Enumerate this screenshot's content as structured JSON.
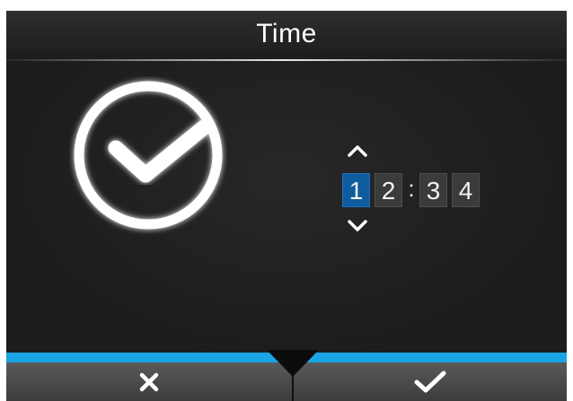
{
  "header": {
    "title": "Time"
  },
  "time_setting": {
    "digits": [
      "1",
      "2",
      "3",
      "4"
    ],
    "separator": ":",
    "selected_index": 0
  },
  "icons": {
    "main": "clock-check-icon",
    "increase": "chevron-up-icon",
    "decrease": "chevron-down-icon",
    "cancel": "close-icon",
    "confirm": "checkmark-icon"
  },
  "colors": {
    "accent": "#1aa4e4",
    "selected_digit": "#0f5c9e",
    "background": "#1f1f1f"
  }
}
